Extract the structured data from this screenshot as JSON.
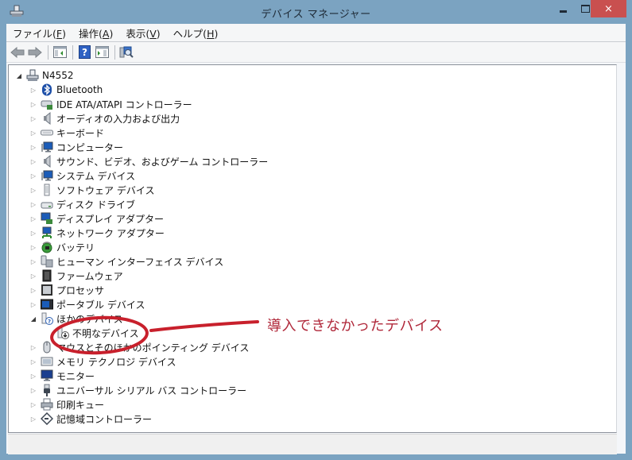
{
  "window": {
    "title": "デバイス マネージャー",
    "controls": {
      "minimize": "minimize",
      "maximize": "maximize",
      "close": "×"
    }
  },
  "menu": [
    {
      "label": "ファイル(",
      "key": "F",
      "suffix": ")"
    },
    {
      "label": "操作(",
      "key": "A",
      "suffix": ")"
    },
    {
      "label": "表示(",
      "key": "V",
      "suffix": ")"
    },
    {
      "label": "ヘルプ(",
      "key": "H",
      "suffix": ")"
    }
  ],
  "toolbar": [
    "back-arrow-icon",
    "forward-arrow-icon",
    "show-hide-console-tree-icon",
    "help-icon",
    "properties-pane-icon",
    "scan-hardware-icon"
  ],
  "tree": {
    "root": "N4552",
    "categories": [
      {
        "label": "Bluetooth",
        "icon": "bluetooth-icon",
        "expanded": false
      },
      {
        "label": "IDE ATA/ATAPI コントローラー",
        "icon": "ide-controller-icon",
        "expanded": false
      },
      {
        "label": "オーディオの入力および出力",
        "icon": "speaker-icon",
        "expanded": false
      },
      {
        "label": "キーボード",
        "icon": "keyboard-icon",
        "expanded": false
      },
      {
        "label": "コンピューター",
        "icon": "computer-icon",
        "expanded": false
      },
      {
        "label": "サウンド、ビデオ、およびゲーム コントローラー",
        "icon": "speaker-icon",
        "expanded": false
      },
      {
        "label": "システム デバイス",
        "icon": "computer-icon",
        "expanded": false
      },
      {
        "label": "ソフトウェア デバイス",
        "icon": "software-device-icon",
        "expanded": false
      },
      {
        "label": "ディスク ドライブ",
        "icon": "disk-drive-icon",
        "expanded": false
      },
      {
        "label": "ディスプレイ アダプター",
        "icon": "display-adapter-icon",
        "expanded": false
      },
      {
        "label": "ネットワーク アダプター",
        "icon": "network-adapter-icon",
        "expanded": false
      },
      {
        "label": "バッテリ",
        "icon": "battery-icon",
        "expanded": false
      },
      {
        "label": "ヒューマン インターフェイス デバイス",
        "icon": "hid-icon",
        "expanded": false
      },
      {
        "label": "ファームウェア",
        "icon": "firmware-icon",
        "expanded": false
      },
      {
        "label": "プロセッサ",
        "icon": "processor-icon",
        "expanded": false
      },
      {
        "label": "ポータブル デバイス",
        "icon": "portable-device-icon",
        "expanded": false
      },
      {
        "label": "ほかのデバイス",
        "icon": "unknown-device-icon",
        "expanded": true,
        "children": [
          {
            "label": "不明なデバイス",
            "icon": "unknown-device-warning-icon"
          }
        ]
      },
      {
        "label": "マウスとそのほかのポインティング デバイス",
        "icon": "mouse-icon",
        "expanded": false
      },
      {
        "label": "メモリ テクノロジ デバイス",
        "icon": "memory-device-icon",
        "expanded": false
      },
      {
        "label": "モニター",
        "icon": "monitor-icon",
        "expanded": false
      },
      {
        "label": "ユニバーサル シリアル バス コントローラー",
        "icon": "usb-icon",
        "expanded": false
      },
      {
        "label": "印刷キュー",
        "icon": "printer-icon",
        "expanded": false
      },
      {
        "label": "記憶域コントローラー",
        "icon": "storage-controller-icon",
        "expanded": false
      }
    ]
  },
  "annotation": {
    "text": "導入できなかったデバイス",
    "color": "#b0283a"
  },
  "colors": {
    "frame": "#7ba3c1",
    "close_button": "#c9504f"
  }
}
